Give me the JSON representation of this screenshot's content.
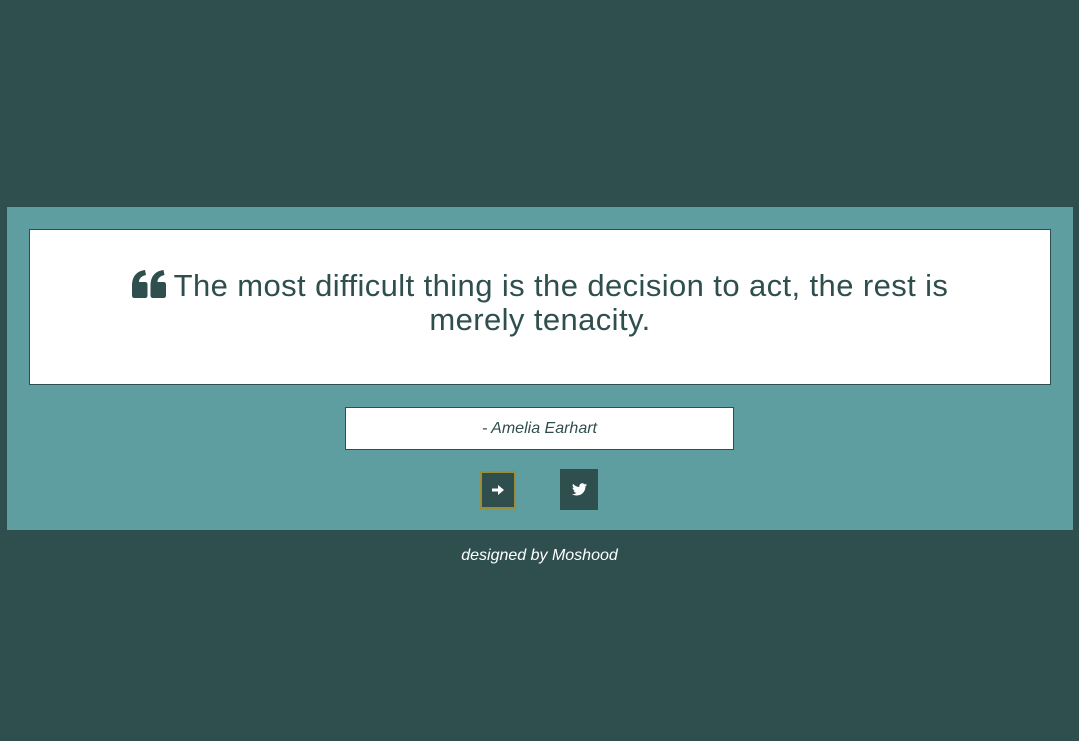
{
  "quote": {
    "text": "The most difficult thing is the decision to act, the rest is merely tenacity.",
    "icon": "quote-left-icon"
  },
  "author": {
    "text": "- Amelia Earhart"
  },
  "buttons": {
    "next_icon": "arrow-right-icon",
    "tweet_icon": "twitter-icon"
  },
  "footer": {
    "text": "designed by Moshood"
  },
  "colors": {
    "background": "#2f4f4f",
    "panel": "#5f9ea0",
    "card": "#ffffff",
    "text": "#2f4f4f",
    "button_border": "#9a8d3a"
  }
}
